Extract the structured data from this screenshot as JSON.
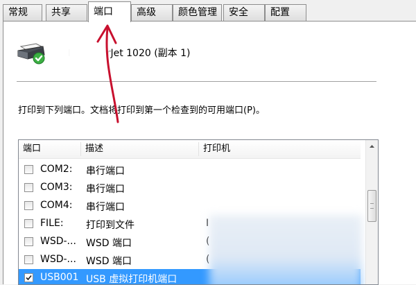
{
  "tabs": [
    {
      "label": "常规"
    },
    {
      "label": "共享"
    },
    {
      "label": "端口",
      "active": true
    },
    {
      "label": "高级"
    },
    {
      "label": "颜色管理"
    },
    {
      "label": "安全"
    },
    {
      "label": "配置"
    }
  ],
  "printer": {
    "name": "HP LaserJet 1020 (副本 1)"
  },
  "description": "打印到下列端口。文档将打印到第一个检查到的可用端口(P)。",
  "port_list": {
    "columns": [
      "端口",
      "描述",
      "打印机"
    ],
    "rows": [
      {
        "port": "COM2:",
        "desc": "串行端口",
        "printer": "",
        "checked": false
      },
      {
        "port": "COM3:",
        "desc": "串行端口",
        "printer": "",
        "checked": false
      },
      {
        "port": "COM4:",
        "desc": "串行端口",
        "printer": "",
        "checked": false
      },
      {
        "port": "FILE:",
        "desc": "打印到文件",
        "printer": "I",
        "checked": false
      },
      {
        "port": "WSD-...",
        "desc": "WSD 端口",
        "printer": "(",
        "checked": false
      },
      {
        "port": "WSD-...",
        "desc": "WSD 端口",
        "printer": "(",
        "checked": false
      },
      {
        "port": "USB001",
        "desc": "USB 虚拟打印机端口",
        "printer": "",
        "checked": true,
        "selected": true
      }
    ]
  },
  "colors": {
    "selection": "#3399ff",
    "annotation_arrow": "#c8102e"
  }
}
